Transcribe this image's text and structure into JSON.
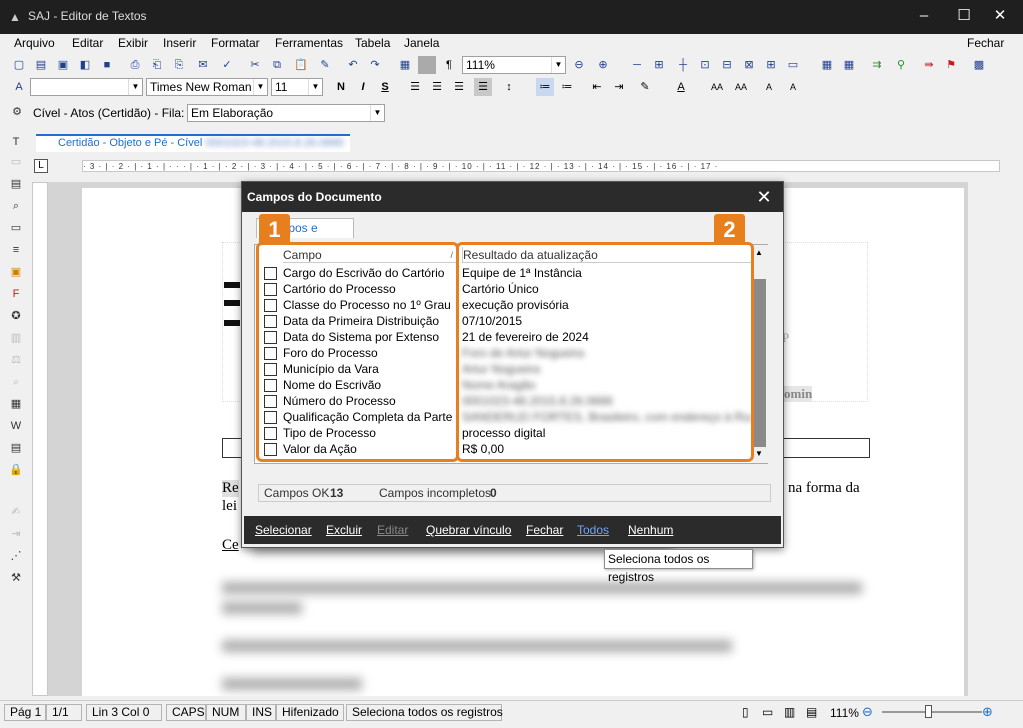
{
  "app": {
    "title": "SAJ - Editor de Textos"
  },
  "menu": {
    "items": [
      "Arquivo",
      "Editar",
      "Exibir",
      "Inserir",
      "Formatar",
      "Ferramentas",
      "Tabela",
      "Janela"
    ],
    "close_label": "Fechar"
  },
  "toolbar": {
    "zoom_value": "111%",
    "font_name": "Times New Roman",
    "font_size": "11",
    "bold": "N",
    "italic": "I",
    "underline": "S"
  },
  "queue": {
    "label": "Cível - Atos (Certidão) - Fila:",
    "value": "Em Elaboração"
  },
  "document_tab": {
    "label": "Certidão - Objeto e Pé - Cível"
  },
  "ruler": {
    "ticks": "· 3 · | · 2 · | · 1 · | · · · | · 1 · | · 2 · | · 3 · | · 4 · | · 5 · | · 6 · | · 7 · | · 8 · | · 9 · | · 10 · | · 11 · | · 12 · | · 13 · | · 14 · | · 15 · | · 16 · | · 17 ·"
  },
  "dialog": {
    "title": "Campos do Documento",
    "tab_label": "Campos e valores",
    "col_field": "Campo",
    "col_result": "Resultado da atualização",
    "rows": [
      {
        "field": "Cargo do Escrivão do Cartório",
        "value": "Equipe de 1ª Instância"
      },
      {
        "field": "Cartório do Processo",
        "value": "Cartório Único"
      },
      {
        "field": "Classe do Processo no 1º Grau",
        "value": "execução provisória"
      },
      {
        "field": "Data da Primeira Distribuição",
        "value": "07/10/2015"
      },
      {
        "field": "Data do Sistema por Extenso",
        "value": "21 de fevereiro de 2024"
      },
      {
        "field": "Foro do Processo",
        "value": "Foro de Artur Nogueira"
      },
      {
        "field": "Município da Vara",
        "value": "Artur Nogueira"
      },
      {
        "field": "Nome do Escrivão",
        "value": "Nome Aragão"
      },
      {
        "field": "Número do Processo",
        "value": "0001023-48.2015.8.26.0666"
      },
      {
        "field": "Qualificação Completa da Parte Passiva",
        "value": "SANDERLEI FORTES, Brasileiro, com endereço à Rua Patrício"
      },
      {
        "field": "Tipo de Processo",
        "value": "processo digital"
      },
      {
        "field": "Valor da Ação",
        "value": "R$ 0,00"
      }
    ],
    "status_ok_label": "Campos OK",
    "status_ok_count": "13",
    "status_incomplete_label": "Campos incompletos",
    "status_incomplete_count": "0",
    "buttons": {
      "select": "Selecionar",
      "delete": "Excluir",
      "edit": "Editar",
      "break_link": "Quebrar vínculo",
      "close": "Fechar",
      "all": "Todos",
      "none": "Nenhum"
    },
    "badge_1": "1",
    "badge_2": "2"
  },
  "tooltip": {
    "text": "Seleciona todos os registros"
  },
  "document": {
    "line_1_start": "Re",
    "line_1_end": "na forma da",
    "line_2_start": "lei",
    "line_3_start": "Ce",
    "frame_text_right_1": "P",
    "frame_text_right_2": "omin"
  },
  "status": {
    "page": "Pág 1",
    "pages": "1/1",
    "position": "Lin 3  Col 0",
    "caps": "CAPS",
    "num": "NUM",
    "ins": "INS",
    "hyphen": "Hifenizado",
    "message": "Seleciona todos os registros",
    "zoom": "111%"
  },
  "colors": {
    "accent": "#e87f1f",
    "tab_blue": "#1e6fd0",
    "dialog_dark": "#2b2b2b"
  }
}
